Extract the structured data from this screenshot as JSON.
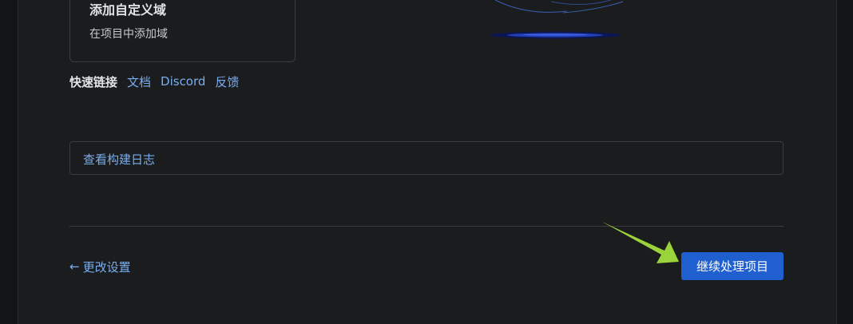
{
  "domain_card": {
    "title": "添加自定义域",
    "description": "在项目中添加域"
  },
  "quick_links": {
    "label": "快速链接",
    "links": [
      "文档",
      "Discord",
      "反馈"
    ]
  },
  "build_log": {
    "label": "查看构建日志"
  },
  "footer": {
    "back_icon": "arrow-left-icon",
    "back_label": "更改设置",
    "continue_label": "继续处理项目"
  },
  "colors": {
    "accent_link": "#79aef0",
    "primary_button": "#1f5fd0",
    "annotation_arrow": "#9bd33a"
  }
}
